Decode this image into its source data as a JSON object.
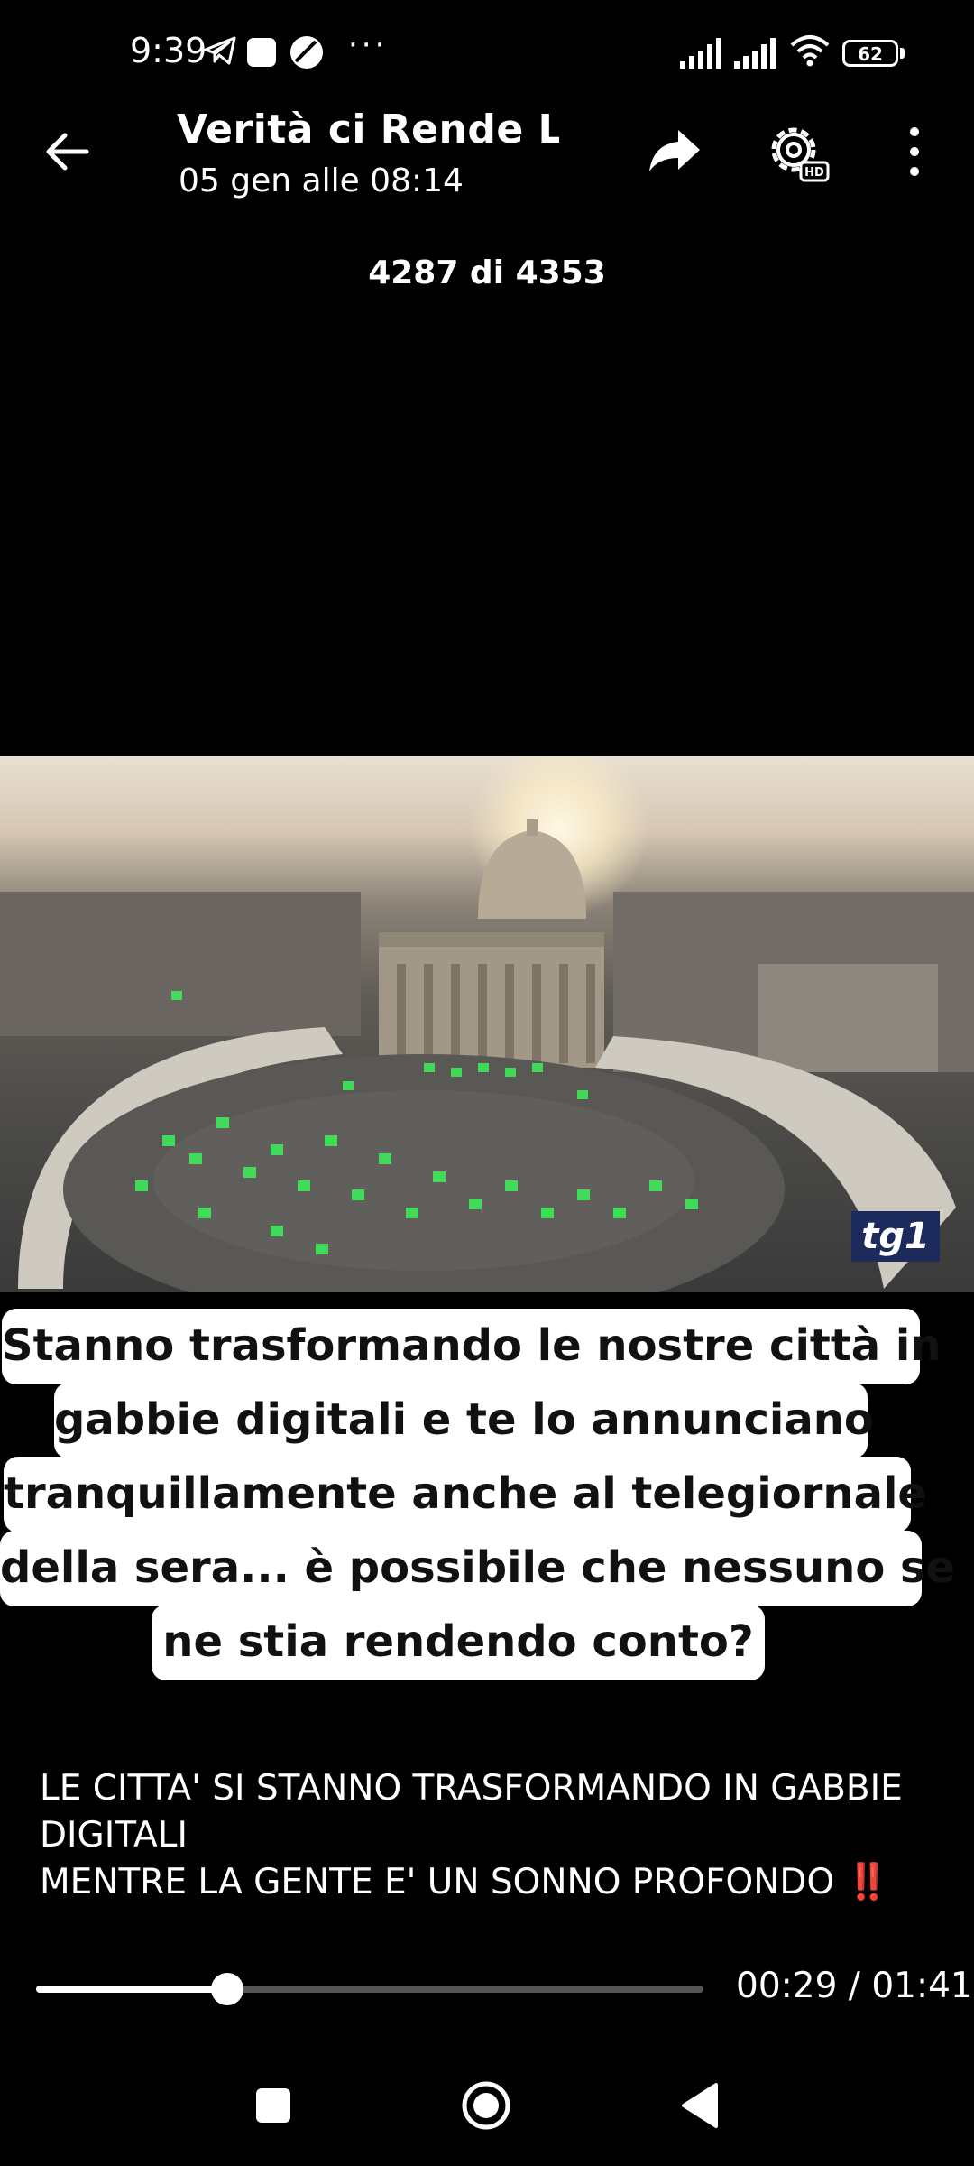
{
  "status_bar": {
    "time": "9:39",
    "more": "···",
    "battery": "62",
    "battery_level": 0.62
  },
  "header": {
    "title": "Verità ci Rende Libe",
    "date": "05 gen alle 08:14",
    "counter": "4287 di 4353"
  },
  "video": {
    "watermark": "tg1",
    "caption_lines": [
      "Stanno trasformando le nostre città in",
      "gabbie digitali e te lo annunciano",
      "tranquillamente anche al telegiornale",
      "della sera... è possibile che nessuno se",
      "ne stia rendendo conto?"
    ]
  },
  "description": {
    "line1": "LE CITTA' SI STANNO TRASFORMANDO IN GABBIE DIGITALI",
    "line2": "MENTRE LA GENTE E' UN SONNO PROFONDO",
    "emoji": "‼️"
  },
  "player": {
    "current_time": "00:29",
    "duration": "01:41",
    "time_display": "00:29 / 01:41",
    "progress": 0.287
  },
  "icons": {
    "back": "arrow-left-icon",
    "share": "share-arrow-icon",
    "settings": "gear-hd-icon",
    "menu": "more-vertical-icon"
  }
}
